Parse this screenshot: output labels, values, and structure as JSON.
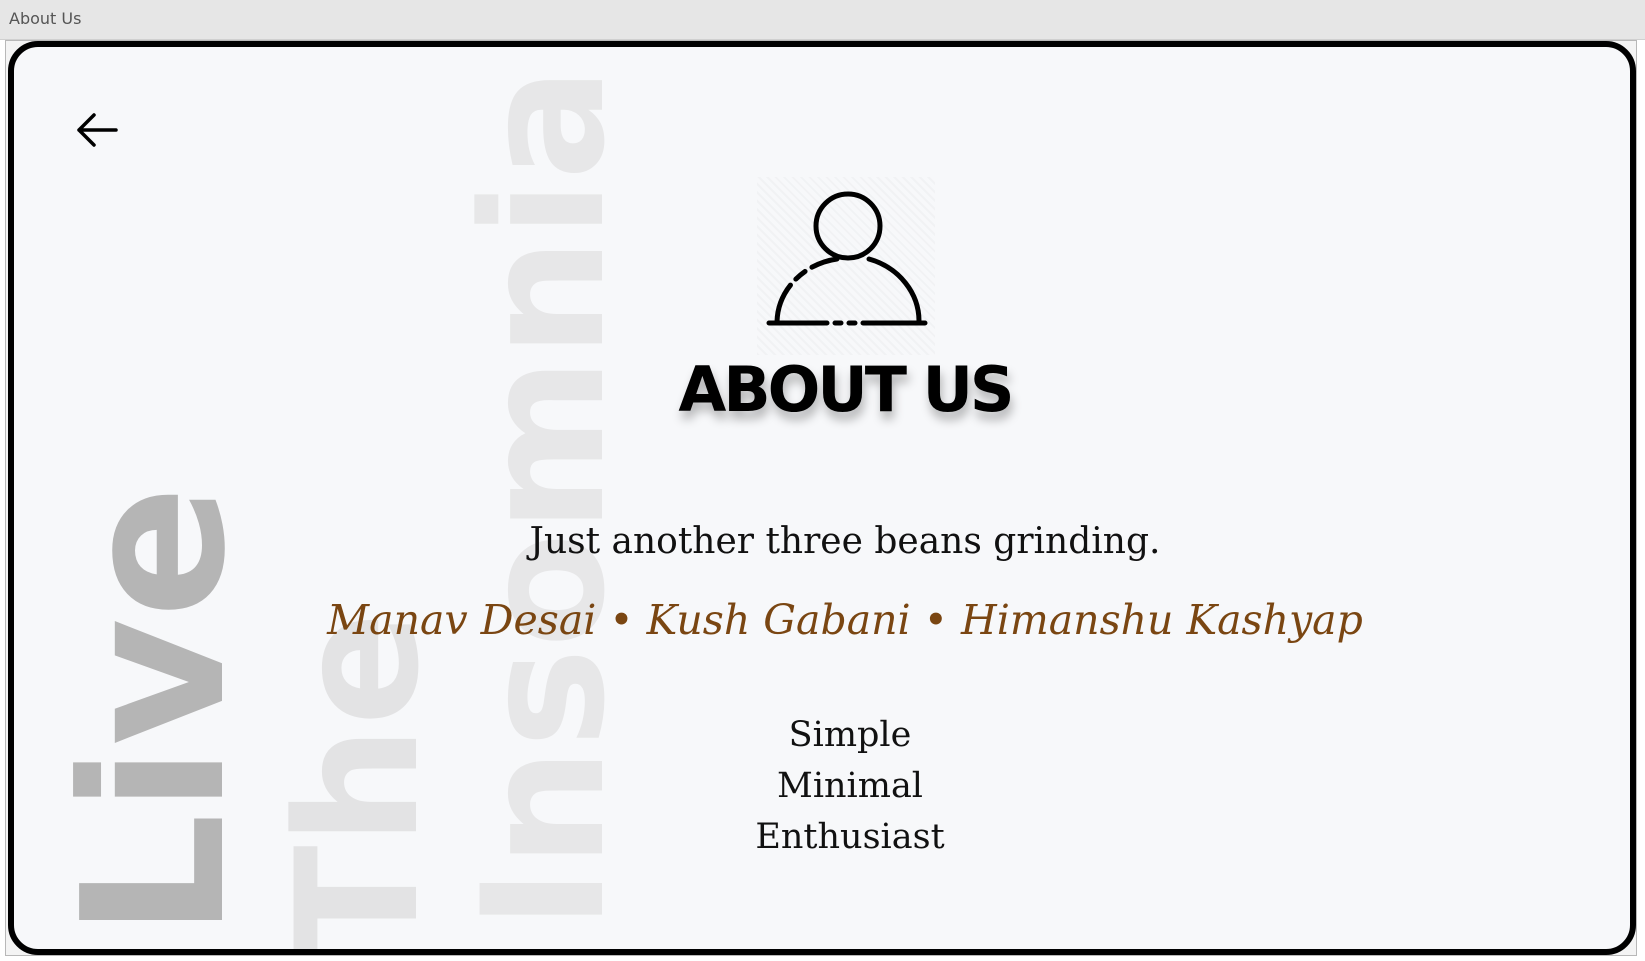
{
  "window": {
    "title": "About Us"
  },
  "watermark": {
    "words": [
      "Live",
      "The",
      "Insomnia"
    ]
  },
  "back": {
    "icon": "arrow-left-icon"
  },
  "avatar": {
    "icon": "user-icon"
  },
  "heading": "ABOUT US",
  "tagline": "Just another three beans grinding.",
  "team": {
    "separator": "•",
    "members": [
      "Manav Desai",
      "Kush Gabani",
      "Himanshu Kashyap"
    ]
  },
  "traits": [
    "Simple",
    "Minimal",
    "Enthusiast"
  ],
  "colors": {
    "card_background": "#f7f8fa",
    "frame": "#000000",
    "names_accent": "#7a4612",
    "watermark_dark": "#b5b5b5",
    "watermark_light": "#e7e7e8"
  }
}
